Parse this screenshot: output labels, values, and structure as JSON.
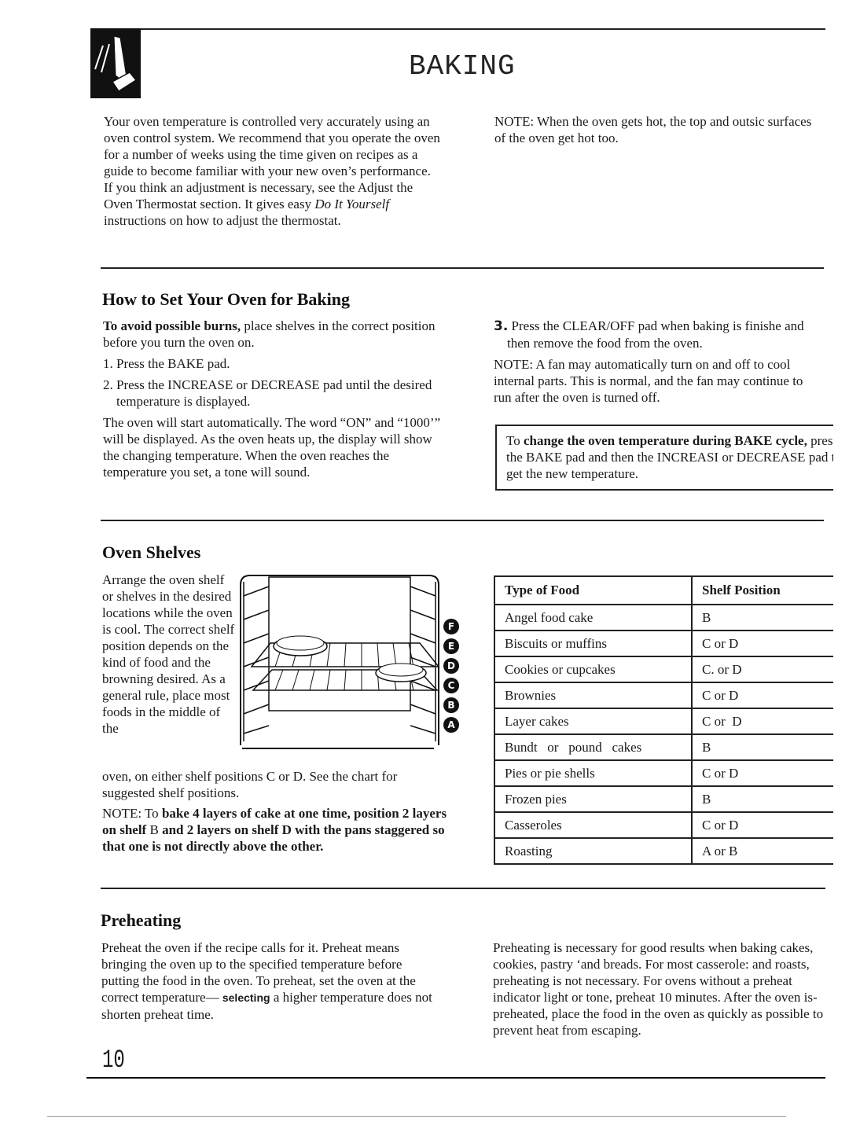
{
  "header": {
    "title": "BAKING",
    "icon": "hand-pressing-pad-icon"
  },
  "intro": {
    "left_text_before_italic": "Your oven temperature is controlled very accurately using an oven control system. We recommend that you operate the oven for a number of weeks using the time given on recipes as a guide to become familiar with your new oven’s performance. If you think an adjustment is necessary, see the Adjust the Oven Thermostat section. It gives easy ",
    "left_italic": "Do It Yourself",
    "left_text_after_italic": " instructions on how to adjust the thermostat.",
    "right_note": "NOTE: When the oven gets hot, the top and outsic surfaces of the oven get hot too."
  },
  "how_to_set": {
    "heading": "How to Set Your Oven for Baking",
    "warning_bold": "To avoid possible burns,",
    "warning_text": " place shelves in the correct position before you turn the oven on.",
    "steps": [
      "1. Press the BAKE pad.",
      "2. Press the INCREASE or DECREASE pad until the desired temperature is displayed."
    ],
    "auto_start": "The oven will start automatically. The word “ON” and “1000’” will be displayed. As the oven heats up, the display will show the changing temperature. When the oven reaches the temperature you set, a tone will sound.",
    "step3_number": "3.",
    "step3_text": " Press the CLEAR/OFF pad when baking is finishe and then remove the food from the oven.",
    "fan_note": "NOTE: A fan may automatically turn on and off to cool internal parts. This is normal, and the fan may continue to run after the oven is turned off.",
    "callout": {
      "prefix": "To ",
      "bold": "change the oven temperature during BAKE cycle,",
      "suffix": " press the BAKE pad and then the INCREASI or DECREASE pad to get the new temperature."
    }
  },
  "oven_shelves": {
    "heading": "Oven Shelves",
    "body": "Arrange the oven shelf or shelves in the desired locations while the oven is cool. The correct shelf position depends on the kind of food and the browning desired. As a general rule, place most foods in the middle of the",
    "body_cont": "oven, on either shelf positions C or D. See the chart for suggested shelf positions.",
    "note_prefix": "NOTE: To ",
    "note_bold_1": "bake 4 layers of cake at one time, position 2 layers on shelf ",
    "note_plain_B": "B",
    "note_bold_2": " and 2 layers on shelf D with the pans staggered so that one is not directly above the other.",
    "shelf_labels": [
      "F",
      "E",
      "D",
      "C",
      "B",
      "A"
    ],
    "table": {
      "headers": [
        "Type of Food",
        "Shelf Position"
      ],
      "rows": [
        [
          "Angel food cake",
          "B"
        ],
        [
          "Biscuits or muffins",
          "C or D"
        ],
        [
          "Cookies or cupcakes",
          "C. or D"
        ],
        [
          "Brownies",
          "C or D"
        ],
        [
          "Layer cakes",
          "C or  D"
        ],
        [
          "Bundt   or   pound   cakes",
          "B"
        ],
        [
          "Pies or pie shells",
          "C or D"
        ],
        [
          "Frozen pies",
          "B"
        ],
        [
          "Casseroles",
          "C or D"
        ],
        [
          "Roasting",
          "A or B"
        ]
      ]
    }
  },
  "preheating": {
    "heading": "Preheating",
    "left_text": "Preheat the oven if the recipe calls for it. Preheat means bringing the oven up to the specified temperature before putting the food in the oven. To preheat, set the oven at the correct temperature—",
    "left_sans_word": "selecting",
    "left_text_end": " a higher temperature does not shorten preheat time.",
    "right_text": "Preheating is necessary for good results when baking cakes, cookies, pastry ‘and breads. For most casserole: and roasts, preheating is not necessary. For ovens without a preheat indicator light or tone, preheat 10 minutes. After the oven is-preheated, place the food in the oven as quickly as possible to prevent heat from escaping."
  },
  "page_number": "10"
}
